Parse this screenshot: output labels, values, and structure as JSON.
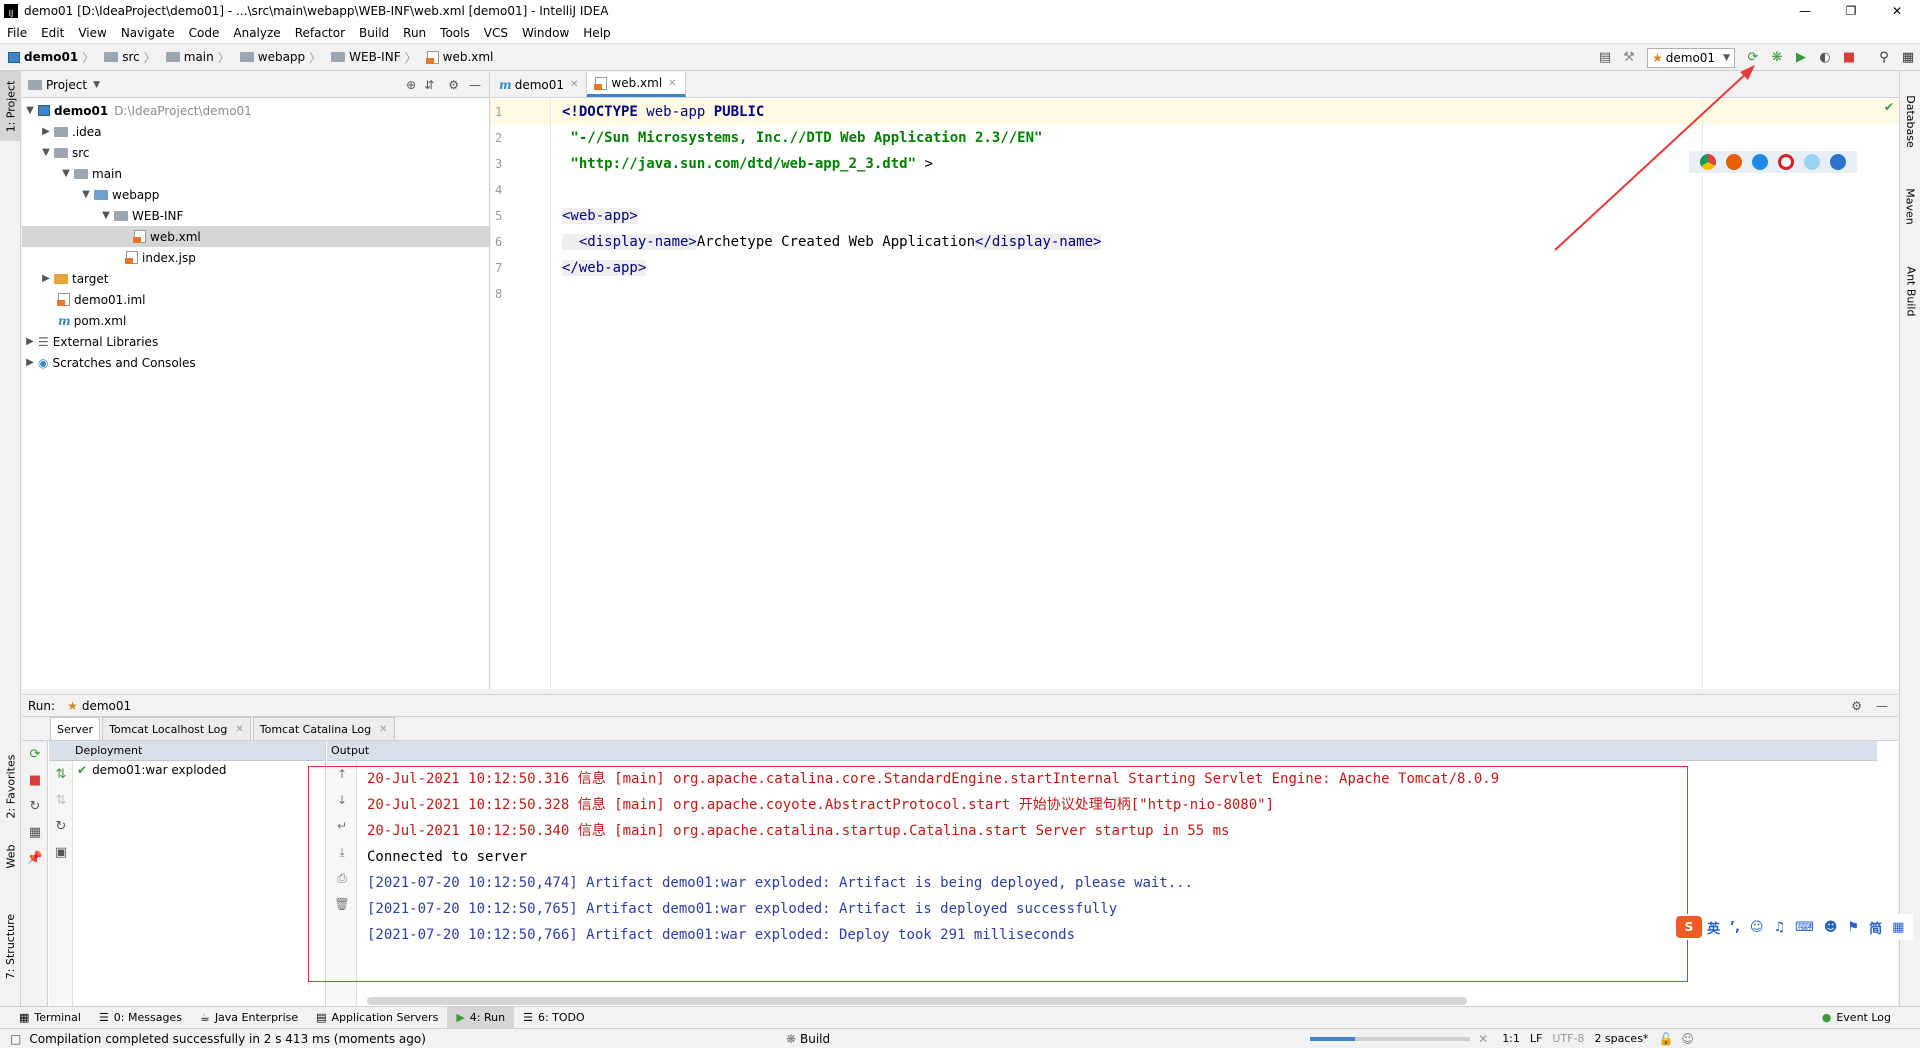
{
  "window": {
    "title": "demo01 [D:\\IdeaProject\\demo01] - ...\\src\\main\\webapp\\WEB-INF\\web.xml [demo01] - IntelliJ IDEA",
    "app_icon_label": "IJ"
  },
  "menu": [
    "File",
    "Edit",
    "View",
    "Navigate",
    "Code",
    "Analyze",
    "Refactor",
    "Build",
    "Run",
    "Tools",
    "VCS",
    "Window",
    "Help"
  ],
  "breadcrumb": [
    "demo01",
    "src",
    "main",
    "webapp",
    "WEB-INF",
    "web.xml"
  ],
  "run_config": "demo01",
  "left_tabs": {
    "project": "1: Project",
    "favorites": "2: Favorites",
    "web": "Web",
    "structure": "7: Structure"
  },
  "right_tabs": {
    "database": "Database",
    "maven": "Maven",
    "ant": "Ant Build"
  },
  "project": {
    "header": "Project",
    "tree": [
      {
        "label": "demo01",
        "extra": "D:\\IdeaProject\\demo01"
      },
      {
        "label": ".idea"
      },
      {
        "label": "src"
      },
      {
        "label": "main"
      },
      {
        "label": "webapp"
      },
      {
        "label": "WEB-INF"
      },
      {
        "label": "web.xml"
      },
      {
        "label": "index.jsp"
      },
      {
        "label": "target"
      },
      {
        "label": "demo01.iml"
      },
      {
        "label": "pom.xml"
      },
      {
        "label": "External Libraries"
      },
      {
        "label": "Scratches and Consoles"
      }
    ]
  },
  "editor": {
    "tabs": [
      {
        "label": "demo01"
      },
      {
        "label": "web.xml"
      }
    ],
    "line_numbers": [
      "1",
      "2",
      "3",
      "4",
      "5",
      "6",
      "7",
      "8"
    ],
    "code": {
      "l1_a": "<!DOCTYPE ",
      "l1_b": "web-app",
      "l1_c": " PUBLIC",
      "l2": " \"-//Sun Microsystems, Inc.//DTD Web Application 2.3//EN\"",
      "l3_a": " \"http://java.sun.com/dtd/web-app_2_3.dtd\"",
      "l3_b": " >",
      "l5": "<web-app>",
      "l6_a": "  <display-name>",
      "l6_b": "Archetype Created Web Application",
      "l6_c": "</display-name>",
      "l7": "</web-app>"
    }
  },
  "run": {
    "label": "Run:",
    "config": "demo01",
    "tabs": [
      {
        "label": "Server"
      },
      {
        "label": "Tomcat Localhost Log"
      },
      {
        "label": "Tomcat Catalina Log"
      }
    ],
    "deployment_header": "Deployment",
    "output_header": "Output",
    "deployment_item": "demo01:war exploded",
    "log": [
      {
        "text": "20-Jul-2021 10:12:50.316 信息 [main] org.apache.catalina.core.StandardEngine.startInternal Starting Servlet Engine: Apache Tomcat/8.0.9",
        "color": "red"
      },
      {
        "text": "20-Jul-2021 10:12:50.328 信息 [main] org.apache.coyote.AbstractProtocol.start 开始协议处理句柄[\"http-nio-8080\"]",
        "color": "red"
      },
      {
        "text": "20-Jul-2021 10:12:50.340 信息 [main] org.apache.catalina.startup.Catalina.start Server startup in 55 ms",
        "color": "red"
      },
      {
        "text": "Connected to server",
        "color": "black"
      },
      {
        "text": "[2021-07-20 10:12:50,474] Artifact demo01:war exploded: Artifact is being deployed, please wait...",
        "color": "blue"
      },
      {
        "text": "[2021-07-20 10:12:50,765] Artifact demo01:war exploded: Artifact is deployed successfully",
        "color": "blue"
      },
      {
        "text": "[2021-07-20 10:12:50,766] Artifact demo01:war exploded: Deploy took 291 milliseconds",
        "color": "blue"
      }
    ]
  },
  "bottom_tabs": [
    {
      "label": "Terminal"
    },
    {
      "label": "0: Messages"
    },
    {
      "label": "Java Enterprise"
    },
    {
      "label": "Application Servers"
    },
    {
      "label": "4: Run"
    },
    {
      "label": "6: TODO"
    }
  ],
  "event_log": "Event Log",
  "status": {
    "message": "Compilation completed successfully in 2 s 413 ms (moments ago)",
    "build": "Build",
    "position": "1:1",
    "line_sep": "LF",
    "encoding": "UTF-8",
    "indent": "2 spaces*"
  },
  "ime": [
    "英",
    "简"
  ],
  "colors": {
    "log_red": "#c41a16",
    "log_blue": "#2c3fa7",
    "accent": "#4083c9",
    "annotation": "#e53a3a"
  }
}
